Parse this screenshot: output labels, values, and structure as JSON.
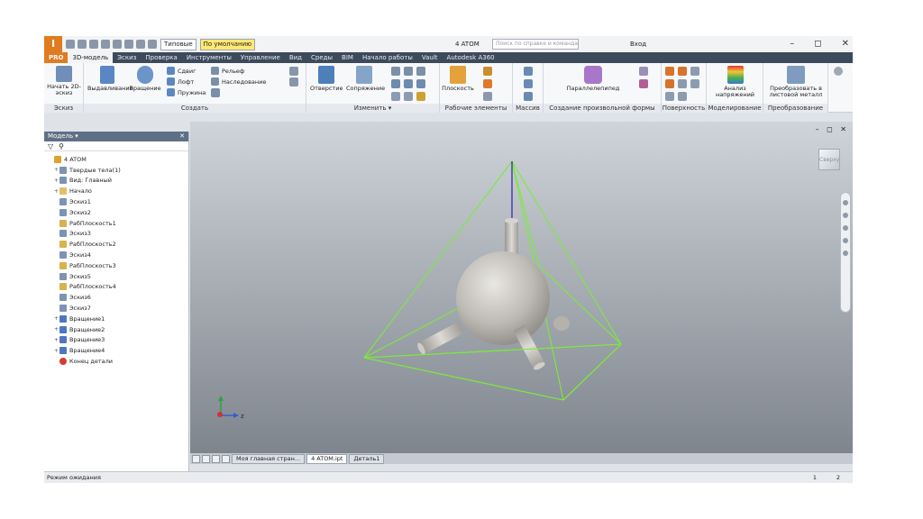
{
  "colors": {
    "accent": "#e07b20",
    "ribbon_tab_bar": "#3c4a5c",
    "wireframe": "#7cea3a",
    "part_surface": "#bfbcb6"
  },
  "logo": {
    "text": "I",
    "subtext": "PRO"
  },
  "title_bar": {
    "style_dropdown": "Типовые",
    "material_dropdown": "По умолчанию",
    "document_title": "4 ATOM",
    "search_placeholder": "Поиск по справке и командам",
    "login": "Вход",
    "help_icon": "help-icon",
    "min": "–",
    "max": "◻",
    "close": "✕"
  },
  "ribbon_tabs": [
    "3D-модель",
    "Эскиз",
    "Проверка",
    "Инструменты",
    "Управление",
    "Вид",
    "Среды",
    "BIM",
    "Начало работы",
    "Vault",
    "Autodesk A360"
  ],
  "ribbon": {
    "sketch": {
      "start_2d_sketch": "Начать 2D-эскиз",
      "group": "Эскиз"
    },
    "create": {
      "extrude": "Выдавливание",
      "revolve": "Вращение",
      "sweep": "Сдвиг",
      "loft": "Лофт",
      "coil": "Пружина",
      "emboss": "Рельеф",
      "derive": "Наследование",
      "group": "Создать"
    },
    "modify": {
      "hole": "Отверстие",
      "fillet": "Сопряжение",
      "group": "Изменить ▾"
    },
    "work_features": {
      "plane": "Плоскость",
      "group": "Рабочие элементы"
    },
    "pattern": {
      "group": "Массив"
    },
    "freeform": {
      "box": "Параллелепипед",
      "group": "Создание произвольной формы"
    },
    "surface": {
      "group": "Поверхность"
    },
    "simulation": {
      "stress": "Анализ напряжений",
      "group": "Моделирование"
    },
    "convert": {
      "to_sheet_metal": "Преобразовать в листовой металл",
      "group": "Преобразование"
    }
  },
  "browser": {
    "title": "Модель ▾",
    "close": "✕",
    "items": [
      {
        "label": "4 ATOM",
        "level": 0,
        "expander": ""
      },
      {
        "label": "Твердые тела(1)",
        "level": 1,
        "expander": "+"
      },
      {
        "label": "Вид: Главный",
        "level": 1,
        "expander": "+"
      },
      {
        "label": "Начало",
        "level": 1,
        "expander": "+"
      },
      {
        "label": "Эскиз1",
        "level": 1,
        "expander": ""
      },
      {
        "label": "Эскиз2",
        "level": 1,
        "expander": ""
      },
      {
        "label": "РабПлоскость1",
        "level": 1,
        "expander": ""
      },
      {
        "label": "Эскиз3",
        "level": 1,
        "expander": ""
      },
      {
        "label": "РабПлоскость2",
        "level": 1,
        "expander": ""
      },
      {
        "label": "Эскиз4",
        "level": 1,
        "expander": ""
      },
      {
        "label": "РабПлоскость3",
        "level": 1,
        "expander": ""
      },
      {
        "label": "Эскиз5",
        "level": 1,
        "expander": ""
      },
      {
        "label": "РабПлоскость4",
        "level": 1,
        "expander": ""
      },
      {
        "label": "Эскиз6",
        "level": 1,
        "expander": ""
      },
      {
        "label": "Эскиз7",
        "level": 1,
        "expander": ""
      },
      {
        "label": "Вращение1",
        "level": 1,
        "expander": "+"
      },
      {
        "label": "Вращение2",
        "level": 1,
        "expander": "+"
      },
      {
        "label": "Вращение3",
        "level": 1,
        "expander": "+"
      },
      {
        "label": "Вращение4",
        "level": 1,
        "expander": "+"
      },
      {
        "label": "Конец детали",
        "level": 1,
        "expander": ""
      }
    ]
  },
  "viewport": {
    "controls": "– ◻ ✕",
    "viewcube_face": "Сверху",
    "axis_z": "z"
  },
  "doc_tabs": [
    "Моя главная стран...",
    "4 ATOM.ipt",
    "Деталь1"
  ],
  "status": {
    "text": "Режим ожидания",
    "n1": "1",
    "n2": "2"
  }
}
